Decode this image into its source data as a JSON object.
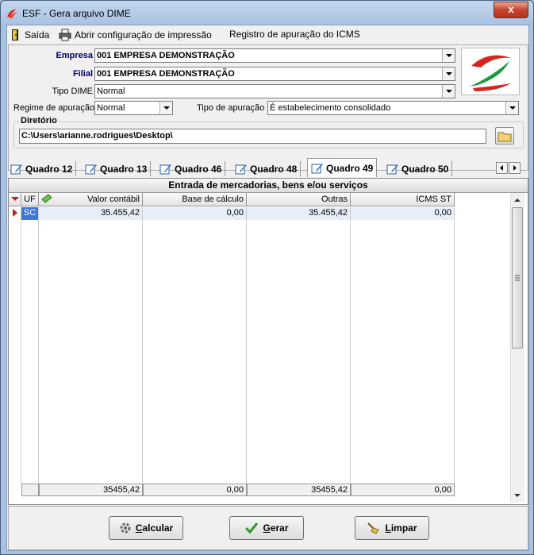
{
  "window": {
    "title": "ESF - Gera arquivo DIME",
    "close_label": "x"
  },
  "menu": {
    "exit": "Saída",
    "print_config": "Abrir configuração de impressão",
    "icms_register": "Registro de apuração do ICMS"
  },
  "form": {
    "empresa_label": "Empresa",
    "empresa_value": "001   EMPRESA DEMONSTRAÇÃO",
    "filial_label": "Filial",
    "filial_value": "001   EMPRESA DEMONSTRAÇÃO",
    "tipo_dime_label": "Tipo DIME",
    "tipo_dime_value": "Normal",
    "regime_label": "Regime de apuração",
    "regime_value": "Normal",
    "tipo_apuracao_label": "Tipo de apuração",
    "tipo_apuracao_value": "É estabelecimento consolidado",
    "diretorio_label": "Diretório",
    "diretorio_value": "C:\\Users\\arianne.rodrigues\\Desktop\\"
  },
  "tabs": [
    "Quadro 12",
    "Quadro 13",
    "Quadro 46",
    "Quadro 48",
    "Quadro 49",
    "Quadro 50"
  ],
  "active_tab": "Quadro 49",
  "grid": {
    "caption": "Entrada de mercadorias, bens e/ou serviços",
    "columns": [
      "UF",
      "Valor contábil",
      "Base de cálculo",
      "Outras",
      "ICMS ST"
    ],
    "rows": [
      {
        "uf": "SC",
        "valor_contabil": "35.455,42",
        "base_calculo": "0,00",
        "outras": "35.455,42",
        "icms_st": "0,00"
      }
    ],
    "totals": {
      "valor_contabil": "35455,42",
      "base_calculo": "0,00",
      "outras": "35455,42",
      "icms_st": "0,00"
    }
  },
  "buttons": {
    "calcular_mnemonic": "C",
    "calcular_rest": "alcular",
    "gerar_mnemonic": "G",
    "gerar_rest": "erar",
    "limpar_mnemonic": "L",
    "limpar_rest": "impar"
  }
}
